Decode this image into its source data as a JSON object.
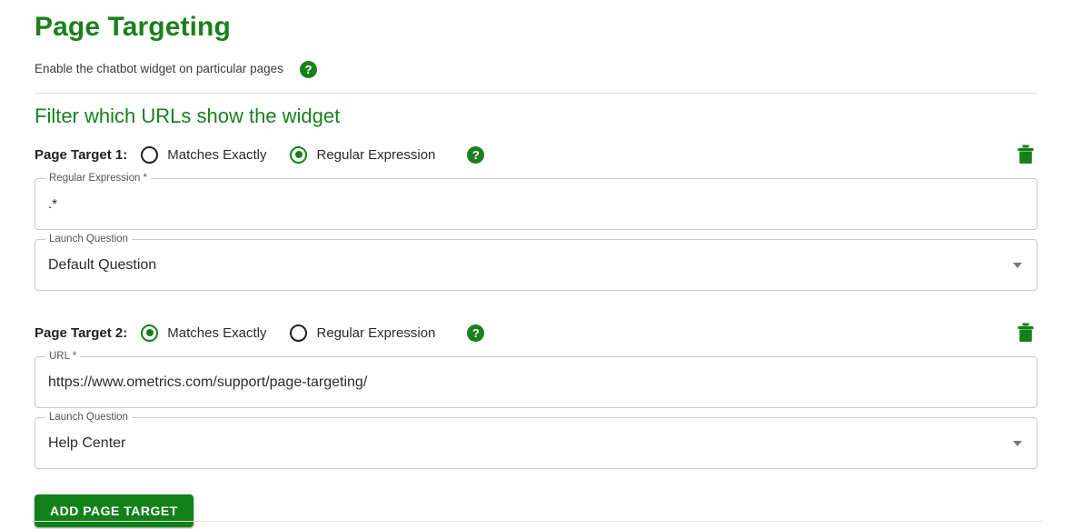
{
  "header": {
    "title": "Page Targeting",
    "subtitle": "Enable the chatbot widget on particular pages",
    "help_icon": "help-circle-icon",
    "help_glyph": "?",
    "section_title": "Filter which URLs show the widget"
  },
  "colors": {
    "brand_green": "#1a801a",
    "title_green": "#1b801b",
    "section_green": "#1a8020",
    "button_green": "#13811a",
    "field_border": "#c9c9c9",
    "divider": "#e2e2e2"
  },
  "targets": [
    {
      "label": "Page Target 1:",
      "options": [
        {
          "label": "Matches Exactly",
          "selected": false
        },
        {
          "label": "Regular Expression",
          "selected": true
        }
      ],
      "help_glyph": "?",
      "delete_icon": "trash-icon",
      "input": {
        "legend": "Regular Expression *",
        "value": ".*"
      },
      "select": {
        "legend": "Launch Question",
        "value": "Default Question",
        "arrow_icon": "chevron-down-icon"
      }
    },
    {
      "label": "Page Target 2:",
      "options": [
        {
          "label": "Matches Exactly",
          "selected": true
        },
        {
          "label": "Regular Expression",
          "selected": false
        }
      ],
      "help_glyph": "?",
      "delete_icon": "trash-icon",
      "input": {
        "legend": "URL *",
        "value": "https://www.ometrics.com/support/page-targeting/"
      },
      "select": {
        "legend": "Launch Question",
        "value": "Help Center",
        "arrow_icon": "chevron-down-icon"
      }
    }
  ],
  "actions": {
    "add_page_target": "ADD PAGE TARGET"
  }
}
